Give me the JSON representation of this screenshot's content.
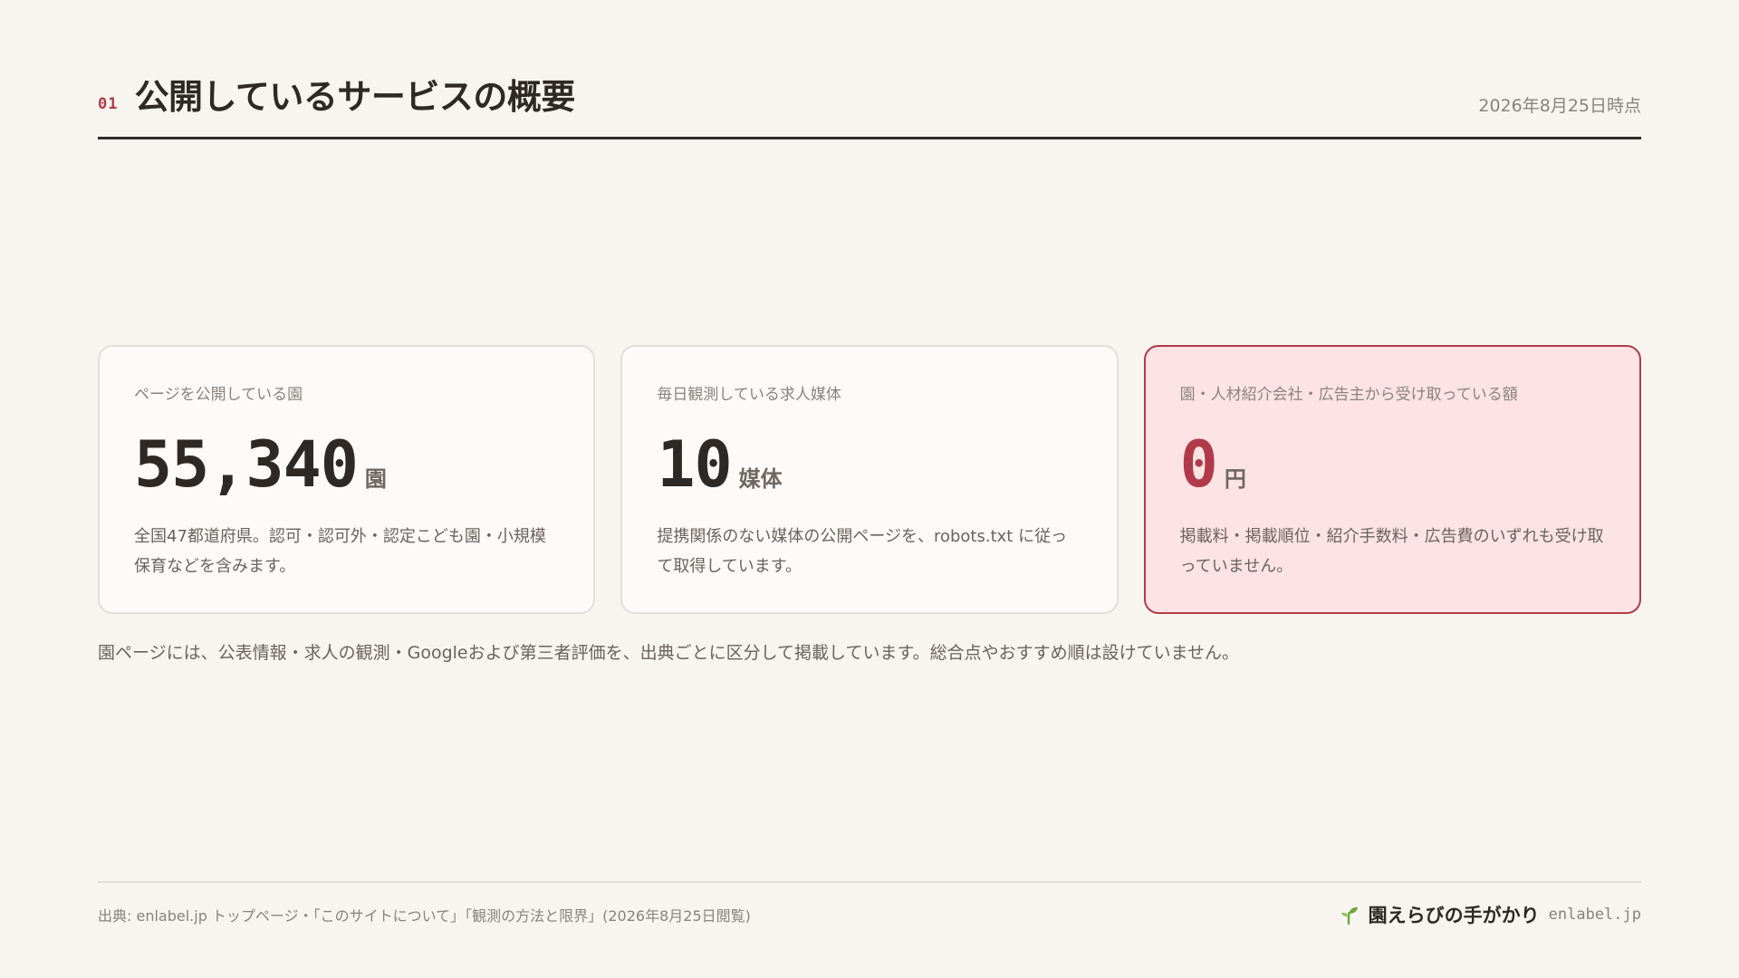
{
  "header": {
    "slide_number": "01",
    "title": "公開しているサービスの概要",
    "as_of": "2026年8月25日時点"
  },
  "cards": [
    {
      "label": "ページを公開している園",
      "value": "55,340",
      "unit": "園",
      "description": "全国47都道府県。認可・認可外・認定こども園・小規模保育などを含みます。"
    },
    {
      "label": "毎日観測している求人媒体",
      "value": "10",
      "unit": "媒体",
      "description": "提携関係のない媒体の公開ページを、robots.txt に従って取得しています。"
    },
    {
      "label": "園・人材紹介会社・広告主から受け取っている額",
      "value": "0",
      "unit": "円",
      "description": "掲載料・掲載順位・紹介手数料・広告費のいずれも受け取っていません。"
    }
  ],
  "note": "園ページには、公表情報・求人の観測・Googleおよび第三者評価を、出典ごとに区分して掲載しています。総合点やおすすめ順は設けていません。",
  "footer": {
    "source": "出典: enlabel.jp トップページ・「このサイトについて」「観測の方法と限界」(2026年8月25日閲覧)",
    "brand_icon": "sprout-icon",
    "brand_name": "園えらびの手がかり",
    "brand_domain": "enlabel.jp"
  },
  "colors": {
    "accent": "#b13a4a",
    "background": "#f8f5f1",
    "highlight_card_bg": "#fde3e4",
    "sprout": "#6aa83a"
  }
}
